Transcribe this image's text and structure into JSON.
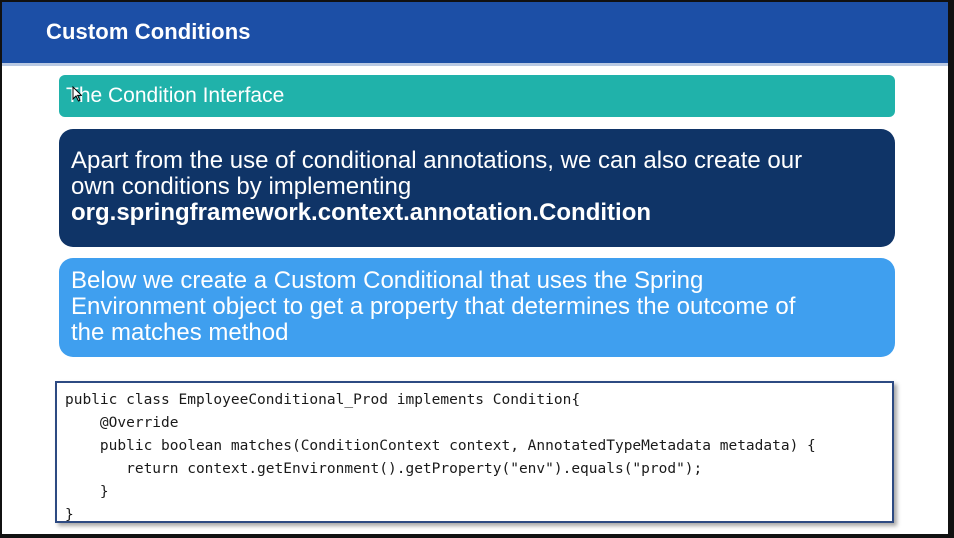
{
  "header": {
    "title": "Custom Conditions"
  },
  "subtitle": {
    "text": "The Condition Interface"
  },
  "intro_box": {
    "line1": "Apart from the use of conditional annotations, we can also create our",
    "line2": "own conditions by implementing",
    "bold_text": "org.springframework.context.annotation.Condition"
  },
  "description_box": {
    "line1": "Below we create a Custom Conditional that uses the Spring",
    "line2": "Environment object to get a property that determines the outcome of",
    "line3": "the matches method"
  },
  "code": {
    "lines": [
      "public class EmployeeConditional_Prod implements Condition{",
      "    @Override",
      "    public boolean matches(ConditionContext context, AnnotatedTypeMetadata metadata) {",
      "       return context.getEnvironment().getProperty(\"env\").equals(\"prod\");",
      "    }",
      "}"
    ]
  },
  "icons": {
    "cursor": "mouse-pointer-icon"
  },
  "colors": {
    "header": "#1c4fa6",
    "subtitle_bar": "#20b2aa",
    "dark_box": "#0f3467",
    "light_box": "#3f9fef",
    "code_border": "#2d4a82"
  }
}
